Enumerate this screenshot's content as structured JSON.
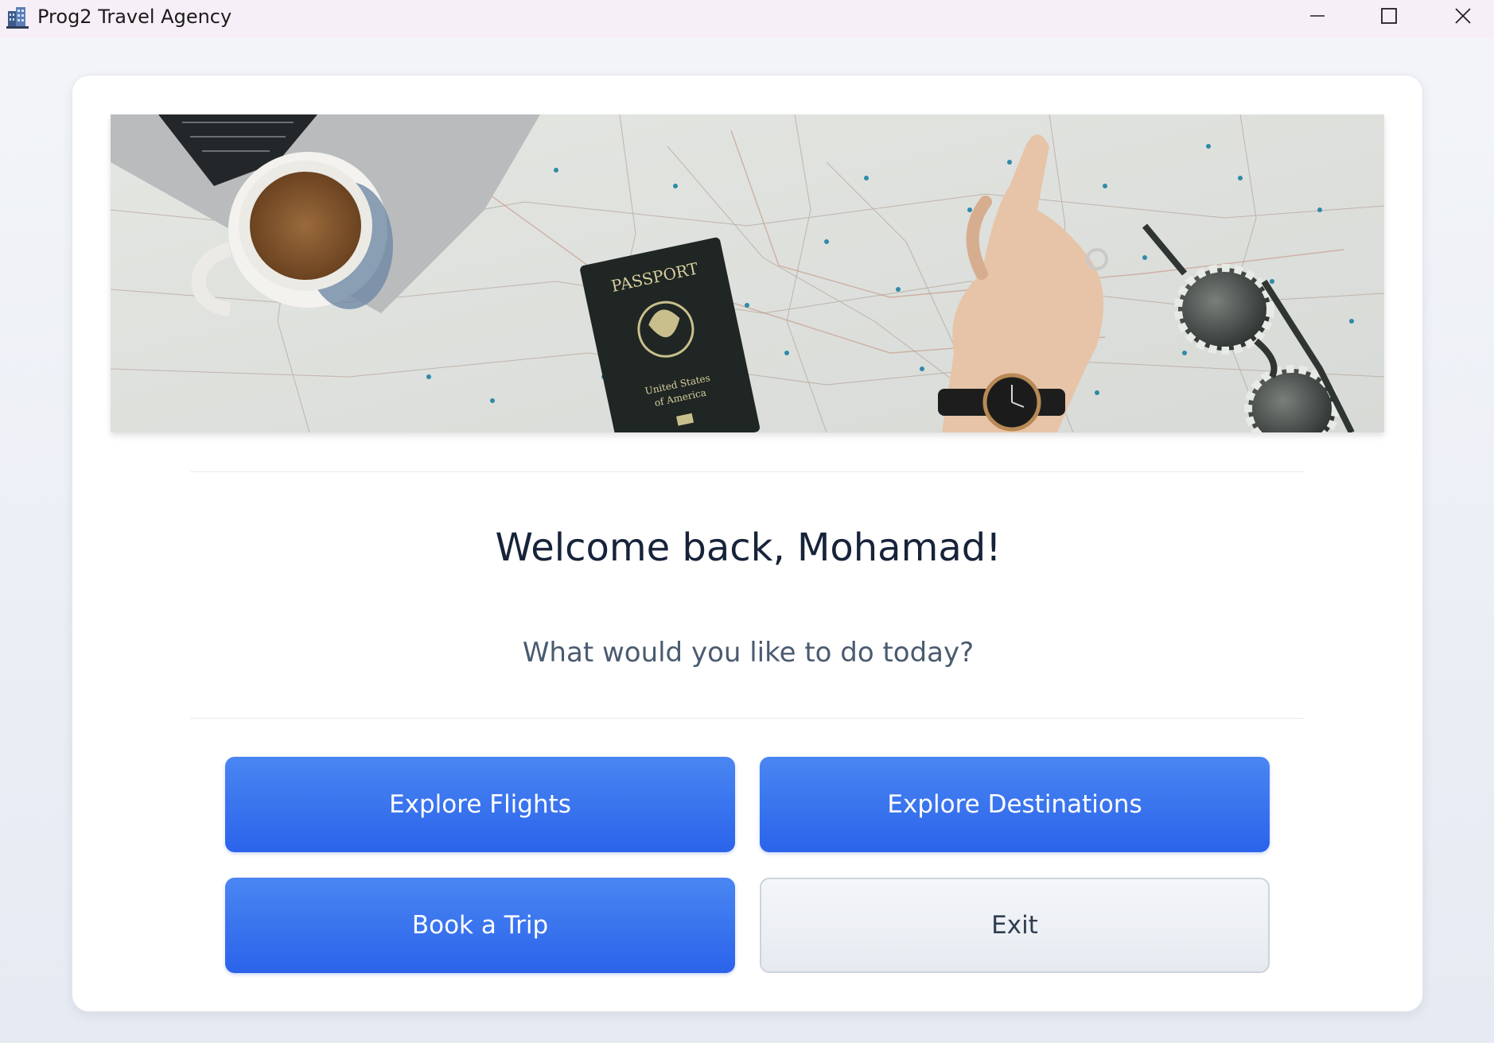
{
  "window": {
    "title": "Prog2 Travel Agency",
    "icon": "building-icon",
    "controls": {
      "minimize": "minimize-icon",
      "maximize": "maximize-icon",
      "close": "close-icon"
    }
  },
  "banner": {
    "passport_title": "PASSPORT",
    "passport_subtitle_1": "United States",
    "passport_subtitle_2": "of America"
  },
  "main": {
    "welcome": "Welcome back, Mohamad!",
    "prompt": "What would you like to do today?"
  },
  "actions": {
    "explore_flights": "Explore Flights",
    "explore_destinations": "Explore Destinations",
    "book_trip": "Book a Trip",
    "exit": "Exit"
  },
  "colors": {
    "primary": "#2b63ea",
    "secondary": "#e6eaf0",
    "heading": "#17233a"
  }
}
